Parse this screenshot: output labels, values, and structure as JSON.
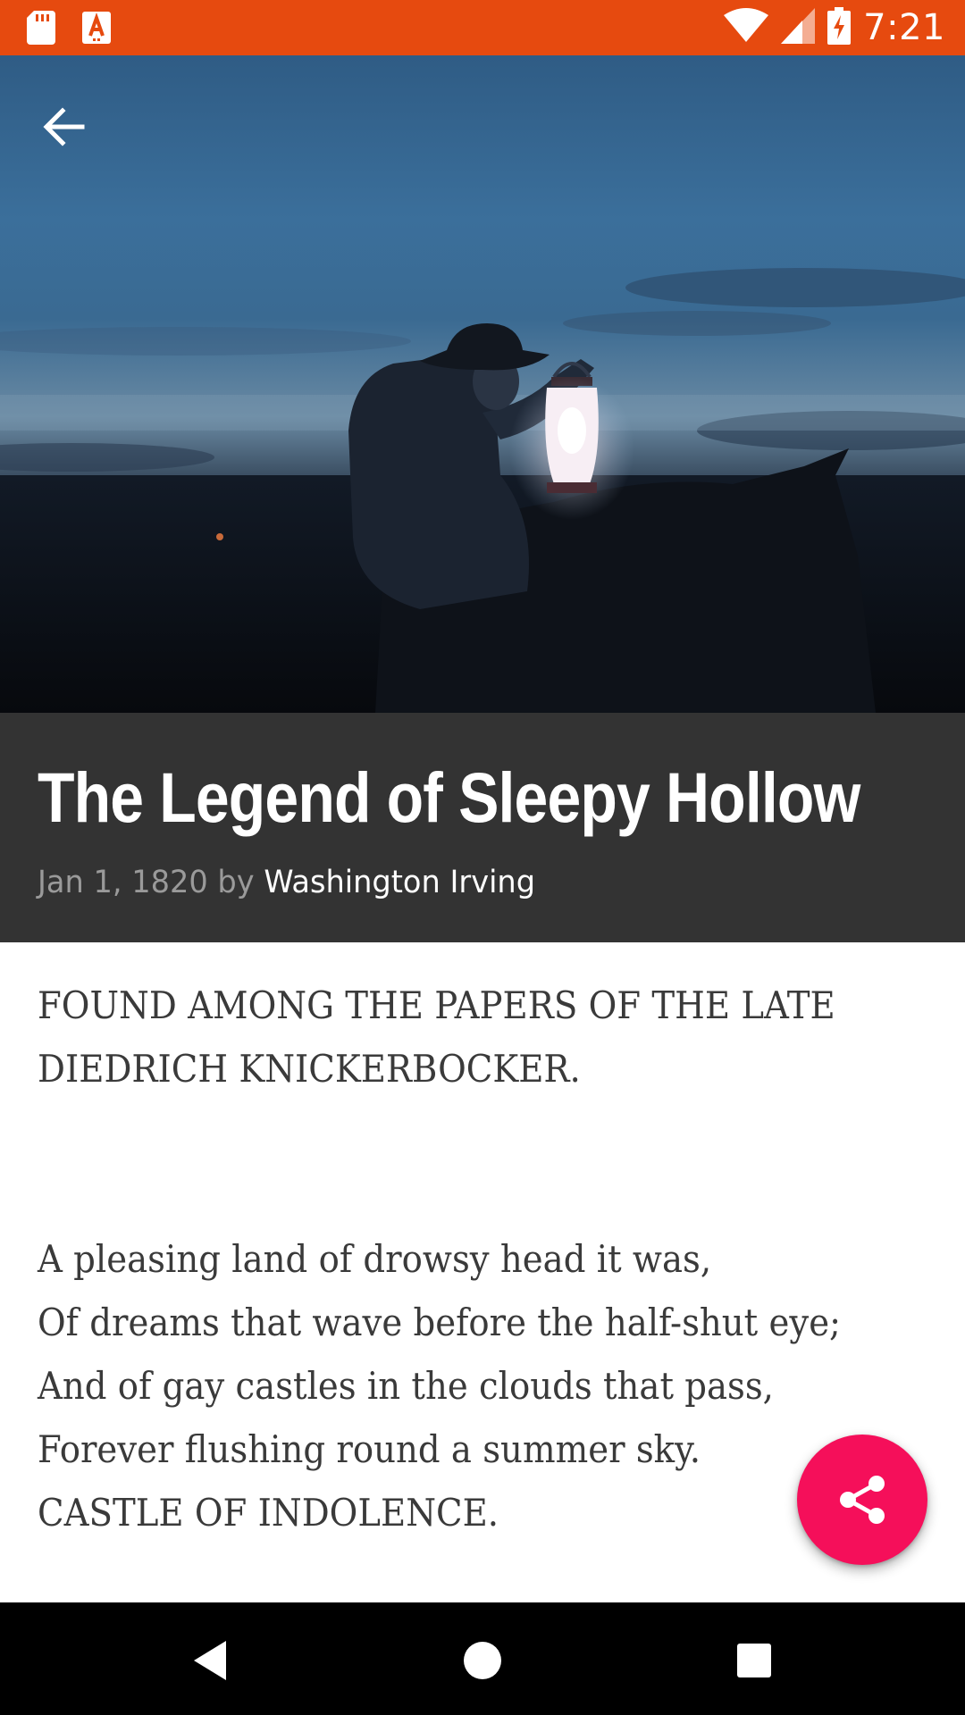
{
  "status_bar": {
    "time": "7:21",
    "background_color": "#e64a0f",
    "icons_left": [
      "sd-card-icon",
      "a-notification-icon"
    ],
    "icons_right": [
      "wifi-icon",
      "cell-signal-icon",
      "battery-charging-icon"
    ]
  },
  "hero": {
    "image": "rider-with-lantern-at-dusk"
  },
  "article": {
    "title": "The Legend of Sleepy Hollow",
    "date": "Jan 1, 1820",
    "by_label": "by",
    "author": "Washington Irving",
    "heading_lines": [
      "FOUND AMONG THE PAPERS OF THE LATE",
      "DIEDRICH KNICKERBOCKER."
    ],
    "poem_lines": [
      "A pleasing land of drowsy head it was,",
      "Of dreams that wave before the half-shut eye;",
      "And of gay castles in the clouds that pass,",
      "Forever flushing round a summer sky.",
      "CASTLE OF INDOLENCE."
    ]
  },
  "fab": {
    "icon": "share-icon",
    "color": "#f50f5a"
  },
  "nav_bar": {
    "buttons": [
      "back-triangle-icon",
      "home-circle-icon",
      "recents-square-icon"
    ]
  }
}
